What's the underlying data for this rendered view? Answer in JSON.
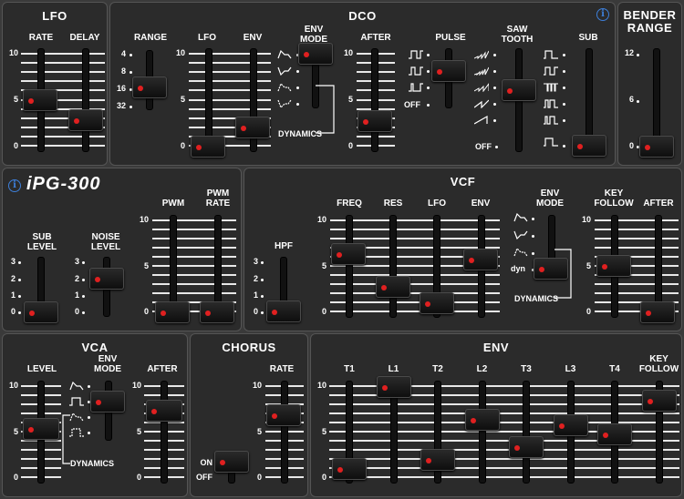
{
  "brand": {
    "name": "iPG-300",
    "info_label": "i"
  },
  "lfo": {
    "title": "LFO",
    "rate_label": "RATE",
    "delay_label": "DELAY",
    "scale": [
      "10",
      "5",
      "0"
    ],
    "rate": 0.5,
    "delay": 0.28
  },
  "dco": {
    "title": "DCO",
    "info_label": "i",
    "range_label": "RANGE",
    "range_options": [
      "4",
      "8",
      "16",
      "32"
    ],
    "range_selected": "16",
    "lfo_label": "LFO",
    "env_label": "ENV",
    "env_mode_label": "ENV\nMODE",
    "after_label": "AFTER",
    "pulse_label": "PULSE",
    "saw_label": "SAW\nTOOTH",
    "sub_label": "SUB",
    "scale": [
      "10",
      "5",
      "0"
    ],
    "pulse_off": "OFF",
    "saw_off": "OFF",
    "dynamics": "DYNAMICS",
    "lfo": 0,
    "env": 0.2,
    "after": 0.27
  },
  "bender": {
    "title": "BENDER\nRANGE",
    "scale": [
      "12",
      "6",
      "0"
    ],
    "value": 0
  },
  "source": {
    "sub_level_label": "SUB\nLEVEL",
    "noise_level_label": "NOISE\nLEVEL",
    "pwm_label": "PWM",
    "pwm_rate_label": "PWM\nRATE",
    "level_scale": [
      "3",
      "2",
      "1",
      "0"
    ],
    "scale": [
      "10",
      "5",
      "0"
    ],
    "sub_level": 0,
    "noise_level": 2,
    "pwm": 0,
    "pwm_rate": 0
  },
  "vcf": {
    "title": "VCF",
    "hpf_label": "HPF",
    "freq_label": "FREQ",
    "res_label": "RES",
    "lfo_label": "LFO",
    "env_label": "ENV",
    "env_mode_label": "ENV\nMODE",
    "key_follow_label": "KEY\nFOLLOW",
    "after_label": "AFTER",
    "hpf_scale": [
      "3",
      "2",
      "1",
      "0"
    ],
    "scale": [
      "10",
      "5",
      "0"
    ],
    "dyn_label": "dyn",
    "dynamics": "DYNAMICS",
    "freq": 0.63,
    "res": 0.27,
    "lfo": 0.1,
    "env": 0.57,
    "key_follow": 0.5,
    "after": 0
  },
  "vca": {
    "title": "VCA",
    "level_label": "LEVEL",
    "env_mode_label": "ENV\nMODE",
    "after_label": "AFTER",
    "scale": [
      "10",
      "5",
      "0"
    ],
    "dynamics": "DYNAMICS",
    "level": 0.53,
    "after": 0.73
  },
  "chorus": {
    "title": "CHORUS",
    "rate_label": "RATE",
    "on_label": "ON",
    "off_label": "OFF",
    "scale": [
      "10",
      "5",
      "0"
    ],
    "rate": 0.68
  },
  "env": {
    "title": "ENV",
    "labels": [
      "T1",
      "L1",
      "T2",
      "L2",
      "T3",
      "L3",
      "T4",
      "KEY\nFOLLOW"
    ],
    "scale": [
      "10",
      "5",
      "0"
    ],
    "values": [
      0.1,
      0.98,
      0.2,
      0.63,
      0.33,
      0.57,
      0.47,
      0.83
    ]
  }
}
